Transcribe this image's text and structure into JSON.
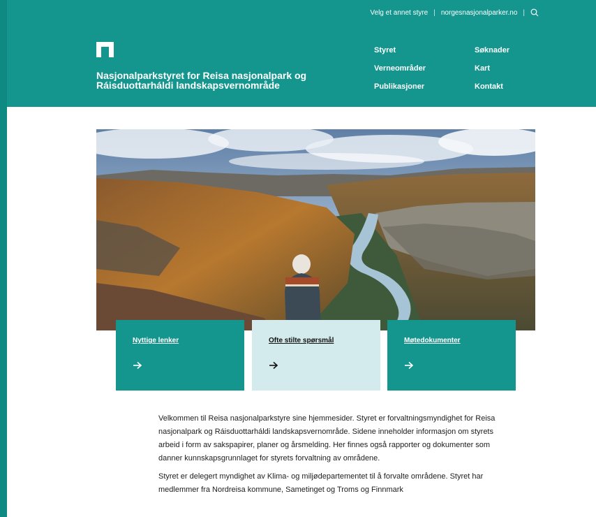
{
  "utility": {
    "choose_board": "Velg et annet styre",
    "site_link": "norgesnasjonalparker.no"
  },
  "site": {
    "title": "Nasjonalparkstyret for Reisa nasjonalpark og Ráisduottarháldi landskapsvernområde"
  },
  "nav": {
    "items": [
      "Styret",
      "Søknader",
      "Verneområder",
      "Kart",
      "Publikasjoner",
      "Kontakt"
    ]
  },
  "cards": [
    {
      "label": "Nyttige lenker"
    },
    {
      "label": "Ofte stilte spørsmål"
    },
    {
      "label": "Møtedokumenter"
    }
  ],
  "content": {
    "p1": "Velkommen til Reisa nasjonalparkstyre sine hjemmesider. Styret er forvaltningsmyndighet for Reisa nasjonalpark og Ráisduottarháldi landskapsvernområde. Sidene inneholder informasjon om styrets arbeid i form av sakspapirer, planer og årsmelding. Her finnes også rapporter og dokumenter som danner kunnskapsgrunnlaget for styrets forvaltning av områdene.",
    "p2": "Styret er delegert myndighet av Klima- og miljødepartementet til å forvalte områdene. Styret har medlemmer fra Nordreisa kommune, Sametinget og Troms og Finnmark"
  },
  "colors": {
    "brand_teal": "#14968e",
    "card_light": "#d3ebec"
  }
}
